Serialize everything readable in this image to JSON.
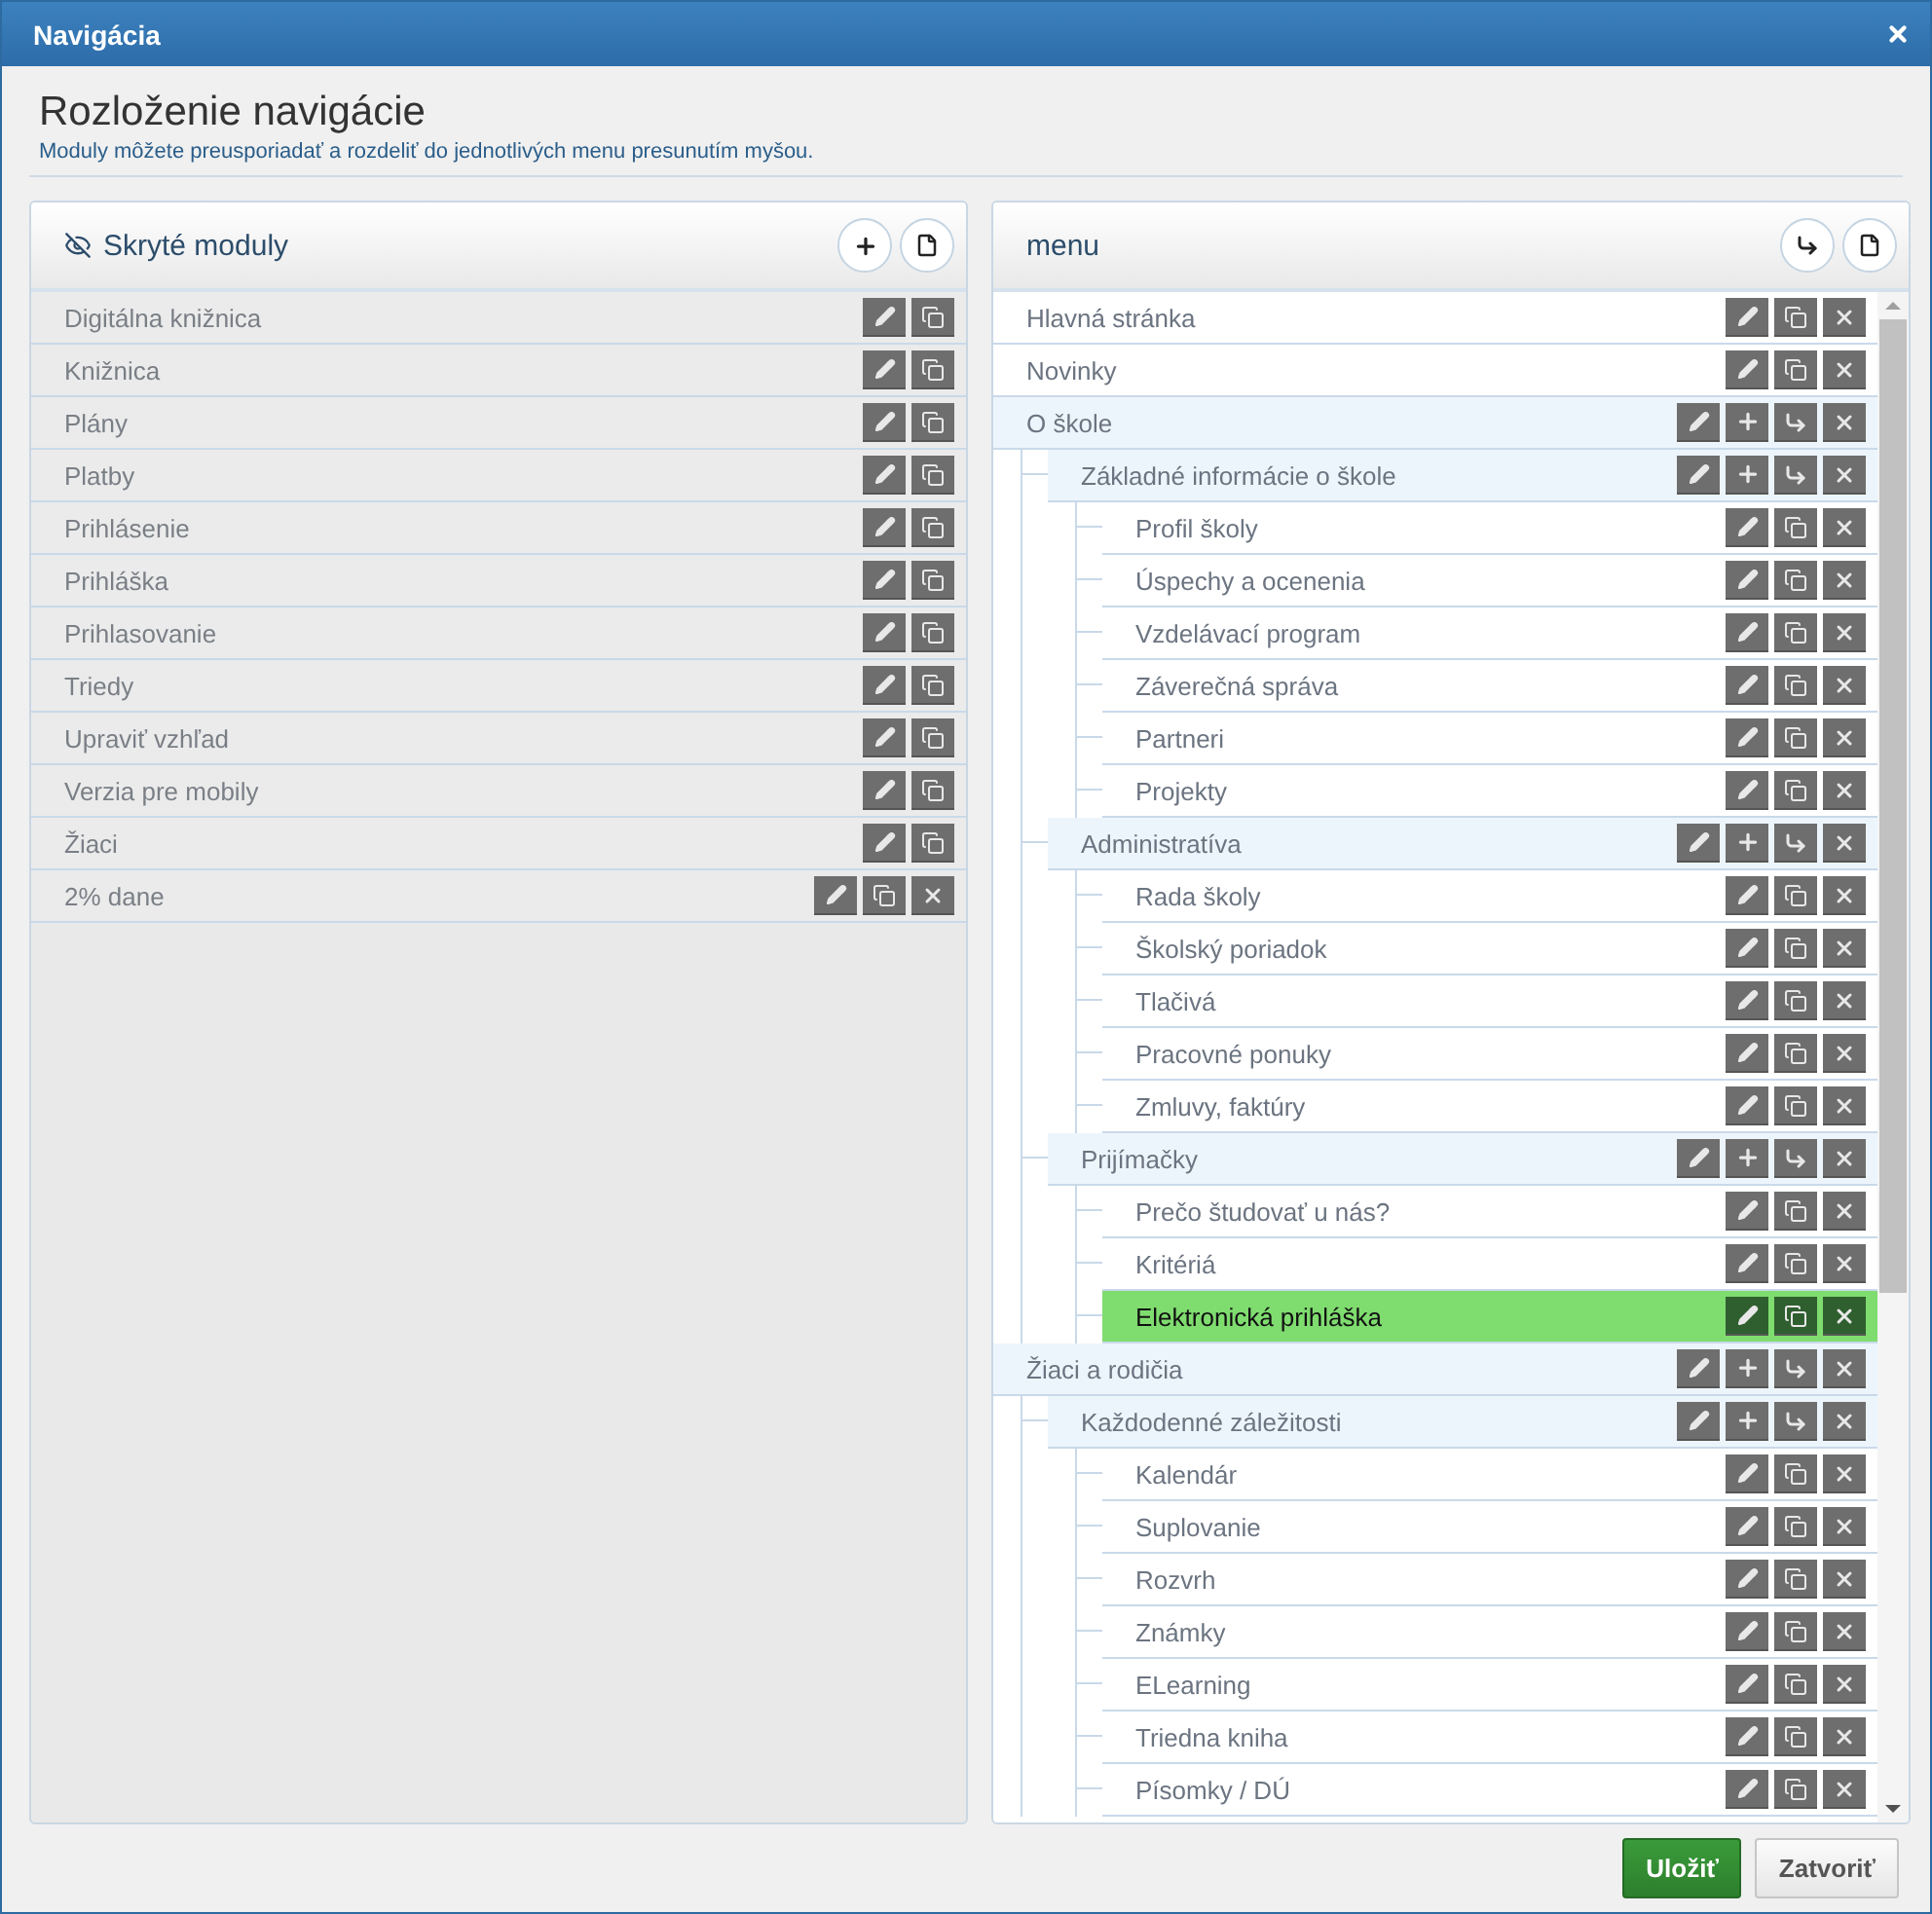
{
  "window": {
    "title": "Navigácia"
  },
  "heading": "Rozloženie navigácie",
  "subtitle": "Moduly môžete preusporiadať a rozdeliť do jednotlivých menu presunutím myšou.",
  "hidden_panel": {
    "title": "Skryté moduly",
    "header_actions": [
      {
        "kind": "add"
      },
      {
        "kind": "page"
      }
    ],
    "items": [
      {
        "label": "Digitálna knižnica",
        "actions": [
          {
            "kind": "edit"
          },
          {
            "kind": "copy"
          }
        ]
      },
      {
        "label": "Knižnica",
        "actions": [
          {
            "kind": "edit"
          },
          {
            "kind": "copy"
          }
        ]
      },
      {
        "label": "Plány",
        "actions": [
          {
            "kind": "edit"
          },
          {
            "kind": "copy"
          }
        ]
      },
      {
        "label": "Platby",
        "actions": [
          {
            "kind": "edit"
          },
          {
            "kind": "copy"
          }
        ]
      },
      {
        "label": "Prihlásenie",
        "actions": [
          {
            "kind": "edit"
          },
          {
            "kind": "copy"
          }
        ]
      },
      {
        "label": "Prihláška",
        "actions": [
          {
            "kind": "edit"
          },
          {
            "kind": "copy"
          }
        ]
      },
      {
        "label": "Prihlasovanie",
        "actions": [
          {
            "kind": "edit"
          },
          {
            "kind": "copy"
          }
        ]
      },
      {
        "label": "Triedy",
        "actions": [
          {
            "kind": "edit"
          },
          {
            "kind": "copy"
          }
        ]
      },
      {
        "label": "Upraviť vzhľad",
        "actions": [
          {
            "kind": "edit"
          },
          {
            "kind": "copy"
          }
        ]
      },
      {
        "label": "Verzia pre mobily",
        "actions": [
          {
            "kind": "edit"
          },
          {
            "kind": "copy"
          }
        ]
      },
      {
        "label": "Žiaci",
        "actions": [
          {
            "kind": "edit"
          },
          {
            "kind": "copy"
          }
        ]
      },
      {
        "label": "2% dane",
        "actions": [
          {
            "kind": "edit"
          },
          {
            "kind": "copy"
          },
          {
            "kind": "delete"
          }
        ]
      }
    ]
  },
  "menu_panel": {
    "title": "menu",
    "header_actions": [
      {
        "kind": "move"
      },
      {
        "kind": "page"
      }
    ],
    "items": [
      {
        "label": "Hlavná stránka",
        "selected": false,
        "actions": [
          {
            "kind": "edit"
          },
          {
            "kind": "copy"
          },
          {
            "kind": "delete"
          }
        ]
      },
      {
        "label": "Novinky",
        "selected": false,
        "actions": [
          {
            "kind": "edit"
          },
          {
            "kind": "copy"
          },
          {
            "kind": "delete"
          }
        ]
      },
      {
        "label": "O škole",
        "selected": false,
        "actions": [
          {
            "kind": "edit"
          },
          {
            "kind": "add"
          },
          {
            "kind": "move"
          },
          {
            "kind": "delete"
          }
        ],
        "children": [
          {
            "label": "Základné informácie o škole",
            "selected": false,
            "actions": [
              {
                "kind": "edit"
              },
              {
                "kind": "add"
              },
              {
                "kind": "move"
              },
              {
                "kind": "delete"
              }
            ],
            "children": [
              {
                "label": "Profil školy",
                "selected": false,
                "actions": [
                  {
                    "kind": "edit"
                  },
                  {
                    "kind": "copy"
                  },
                  {
                    "kind": "delete"
                  }
                ]
              },
              {
                "label": "Úspechy a ocenenia",
                "selected": false,
                "actions": [
                  {
                    "kind": "edit"
                  },
                  {
                    "kind": "copy"
                  },
                  {
                    "kind": "delete"
                  }
                ]
              },
              {
                "label": "Vzdelávací program",
                "selected": false,
                "actions": [
                  {
                    "kind": "edit"
                  },
                  {
                    "kind": "copy"
                  },
                  {
                    "kind": "delete"
                  }
                ]
              },
              {
                "label": "Záverečná správa",
                "selected": false,
                "actions": [
                  {
                    "kind": "edit"
                  },
                  {
                    "kind": "copy"
                  },
                  {
                    "kind": "delete"
                  }
                ]
              },
              {
                "label": "Partneri",
                "selected": false,
                "actions": [
                  {
                    "kind": "edit"
                  },
                  {
                    "kind": "copy"
                  },
                  {
                    "kind": "delete"
                  }
                ]
              },
              {
                "label": "Projekty",
                "selected": false,
                "actions": [
                  {
                    "kind": "edit"
                  },
                  {
                    "kind": "copy"
                  },
                  {
                    "kind": "delete"
                  }
                ]
              }
            ]
          },
          {
            "label": "Administratíva",
            "selected": false,
            "actions": [
              {
                "kind": "edit"
              },
              {
                "kind": "add"
              },
              {
                "kind": "move"
              },
              {
                "kind": "delete"
              }
            ],
            "children": [
              {
                "label": "Rada školy",
                "selected": false,
                "actions": [
                  {
                    "kind": "edit"
                  },
                  {
                    "kind": "copy"
                  },
                  {
                    "kind": "delete"
                  }
                ]
              },
              {
                "label": "Školský poriadok",
                "selected": false,
                "actions": [
                  {
                    "kind": "edit"
                  },
                  {
                    "kind": "copy"
                  },
                  {
                    "kind": "delete"
                  }
                ]
              },
              {
                "label": "Tlačivá",
                "selected": false,
                "actions": [
                  {
                    "kind": "edit"
                  },
                  {
                    "kind": "copy"
                  },
                  {
                    "kind": "delete"
                  }
                ]
              },
              {
                "label": "Pracovné ponuky",
                "selected": false,
                "actions": [
                  {
                    "kind": "edit"
                  },
                  {
                    "kind": "copy"
                  },
                  {
                    "kind": "delete"
                  }
                ]
              },
              {
                "label": "Zmluvy, faktúry",
                "selected": false,
                "actions": [
                  {
                    "kind": "edit"
                  },
                  {
                    "kind": "copy"
                  },
                  {
                    "kind": "delete"
                  }
                ]
              }
            ]
          },
          {
            "label": "Prijímačky",
            "selected": false,
            "actions": [
              {
                "kind": "edit"
              },
              {
                "kind": "add"
              },
              {
                "kind": "move"
              },
              {
                "kind": "delete"
              }
            ],
            "children": [
              {
                "label": "Prečo študovať u nás?",
                "selected": false,
                "actions": [
                  {
                    "kind": "edit"
                  },
                  {
                    "kind": "copy"
                  },
                  {
                    "kind": "delete"
                  }
                ]
              },
              {
                "label": "Kritériá",
                "selected": false,
                "actions": [
                  {
                    "kind": "edit"
                  },
                  {
                    "kind": "copy"
                  },
                  {
                    "kind": "delete"
                  }
                ]
              },
              {
                "label": "Elektronická prihláška",
                "selected": true,
                "actions": [
                  {
                    "kind": "edit"
                  },
                  {
                    "kind": "copy"
                  },
                  {
                    "kind": "delete"
                  }
                ]
              }
            ]
          }
        ]
      },
      {
        "label": "Žiaci a rodičia",
        "selected": false,
        "actions": [
          {
            "kind": "edit"
          },
          {
            "kind": "add"
          },
          {
            "kind": "move"
          },
          {
            "kind": "delete"
          }
        ],
        "children": [
          {
            "label": "Každodenné záležitosti",
            "selected": false,
            "actions": [
              {
                "kind": "edit"
              },
              {
                "kind": "add"
              },
              {
                "kind": "move"
              },
              {
                "kind": "delete"
              }
            ],
            "children": [
              {
                "label": "Kalendár",
                "selected": false,
                "actions": [
                  {
                    "kind": "edit"
                  },
                  {
                    "kind": "copy"
                  },
                  {
                    "kind": "delete"
                  }
                ]
              },
              {
                "label": "Suplovanie",
                "selected": false,
                "actions": [
                  {
                    "kind": "edit"
                  },
                  {
                    "kind": "copy"
                  },
                  {
                    "kind": "delete"
                  }
                ]
              },
              {
                "label": "Rozvrh",
                "selected": false,
                "actions": [
                  {
                    "kind": "edit"
                  },
                  {
                    "kind": "copy"
                  },
                  {
                    "kind": "delete"
                  }
                ]
              },
              {
                "label": "Známky",
                "selected": false,
                "actions": [
                  {
                    "kind": "edit"
                  },
                  {
                    "kind": "copy"
                  },
                  {
                    "kind": "delete"
                  }
                ]
              },
              {
                "label": "ELearning",
                "selected": false,
                "actions": [
                  {
                    "kind": "edit"
                  },
                  {
                    "kind": "copy"
                  },
                  {
                    "kind": "delete"
                  }
                ]
              },
              {
                "label": "Triedna kniha",
                "selected": false,
                "actions": [
                  {
                    "kind": "edit"
                  },
                  {
                    "kind": "copy"
                  },
                  {
                    "kind": "delete"
                  }
                ]
              },
              {
                "label": "Písomky / DÚ",
                "selected": false,
                "actions": [
                  {
                    "kind": "edit"
                  },
                  {
                    "kind": "copy"
                  },
                  {
                    "kind": "delete"
                  }
                ]
              }
            ]
          }
        ]
      }
    ]
  },
  "buttons": [
    {
      "label": "Uložiť",
      "kind": "primary"
    },
    {
      "label": "Zatvoriť",
      "kind": "default"
    }
  ]
}
